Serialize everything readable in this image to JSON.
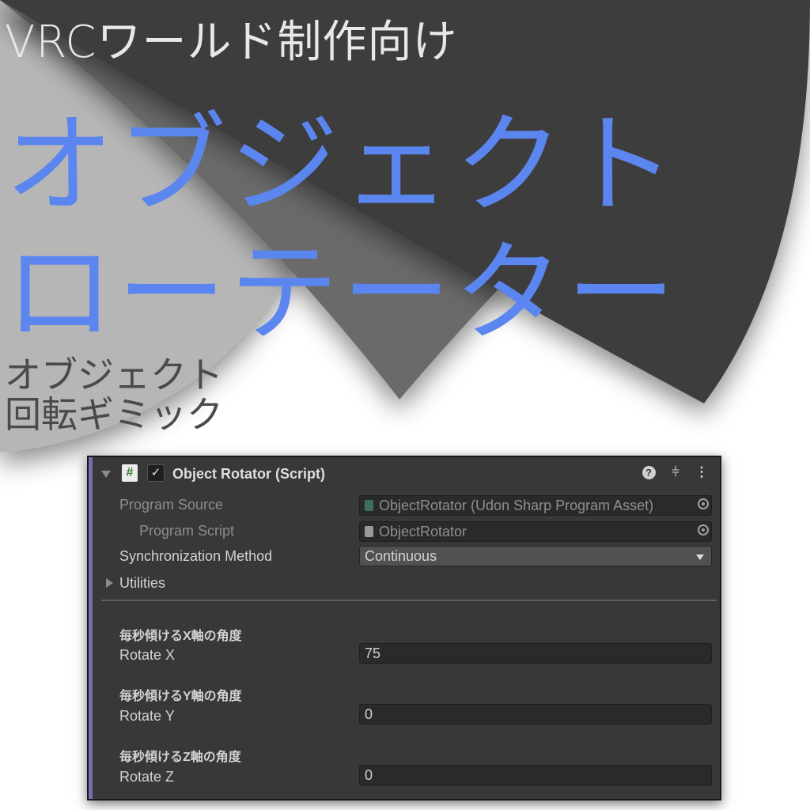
{
  "title": {
    "small": "VRCワールド制作向け",
    "big_line1": "オブジェクト",
    "big_line2": "ローテーター",
    "sub_line1": "オブジェクト",
    "sub_line2": "回転ギミック"
  },
  "colors": {
    "accent_blue": "#5b86f0",
    "panel_bg": "#383838",
    "fan_dark": "#3c3c3c",
    "inspector_accent": "#7e6bb5"
  },
  "inspector": {
    "component_title": "Object Rotator (Script)",
    "enabled": true,
    "icons": {
      "foldout": "triangle-down-icon",
      "script": "hash-icon",
      "help": "help-icon",
      "presets": "sliders-icon",
      "menu": "kebab-menu-icon"
    },
    "fields": {
      "program_source": {
        "label": "Program Source",
        "value": "ObjectRotator (Udon Sharp Program Asset)"
      },
      "program_script": {
        "label": "Program Script",
        "value": "ObjectRotator"
      },
      "sync_method": {
        "label": "Synchronization Method",
        "value": "Continuous"
      },
      "utilities": {
        "label": "Utilities"
      }
    },
    "sections": [
      {
        "header": "毎秒傾けるX軸の角度",
        "label": "Rotate X",
        "value": "75"
      },
      {
        "header": "毎秒傾けるY軸の角度",
        "label": "Rotate Y",
        "value": "0"
      },
      {
        "header": "毎秒傾けるZ軸の角度",
        "label": "Rotate Z",
        "value": "0"
      }
    ]
  }
}
